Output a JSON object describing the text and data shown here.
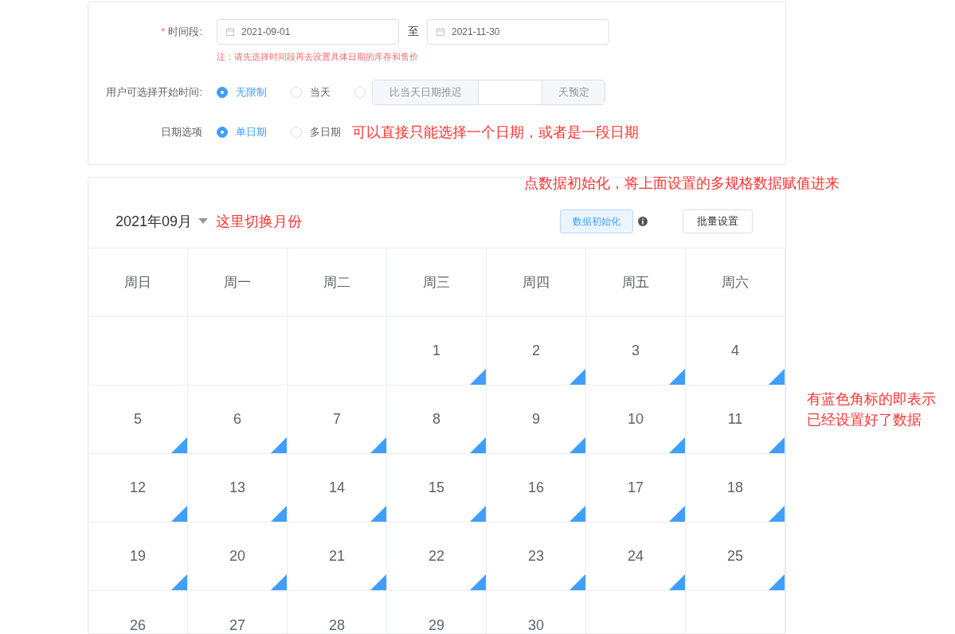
{
  "form": {
    "period": {
      "label": "时间段:",
      "required_mark": "*",
      "start": "2021-09-01",
      "separator": "至",
      "end": "2021-11-30",
      "note": "注：请先选择时间段再去设置具体日期的库存和售价"
    },
    "start_time": {
      "label": "用户可选择开始时间:",
      "options": [
        {
          "kind": "radio",
          "label": "无限制",
          "selected": true
        },
        {
          "kind": "radio",
          "label": "当天",
          "selected": false
        },
        {
          "kind": "delay",
          "selected": false,
          "prefix": "比当天日期推迟",
          "suffix": "天预定"
        }
      ]
    },
    "date_option": {
      "label": "日期选项",
      "options": [
        {
          "kind": "radio",
          "label": "单日期",
          "selected": true
        },
        {
          "kind": "radio",
          "label": "多日期",
          "selected": false
        }
      ],
      "note": "可以直接只能选择一个日期，或者是一段日期"
    }
  },
  "calendar": {
    "month": "2021年09月",
    "month_note": "这里切换月份",
    "init_note": "点数据初始化，将上面设置的多规格数据赋值进来",
    "init_button": "数据初始化",
    "batch_button": "批量设置",
    "side_note": "有蓝色角标的即表示已经设置好了数据",
    "weekdays": [
      "周日",
      "周一",
      "周二",
      "周三",
      "周四",
      "周五",
      "周六"
    ],
    "weeks": [
      [
        {
          "kind": "blank"
        },
        {
          "kind": "blank"
        },
        {
          "kind": "blank"
        },
        {
          "kind": "day",
          "day": "1",
          "corner": true
        },
        {
          "kind": "day",
          "day": "2",
          "corner": true
        },
        {
          "kind": "day",
          "day": "3",
          "corner": true
        },
        {
          "kind": "day",
          "day": "4",
          "corner": true
        }
      ],
      [
        {
          "kind": "day",
          "day": "5",
          "corner": true
        },
        {
          "kind": "day",
          "day": "6",
          "corner": true
        },
        {
          "kind": "day",
          "day": "7",
          "corner": true
        },
        {
          "kind": "day",
          "day": "8",
          "corner": true
        },
        {
          "kind": "day",
          "day": "9",
          "corner": true
        },
        {
          "kind": "day",
          "day": "10",
          "corner": true
        },
        {
          "kind": "day",
          "day": "11",
          "corner": true
        }
      ],
      [
        {
          "kind": "day",
          "day": "12",
          "corner": true
        },
        {
          "kind": "day",
          "day": "13",
          "corner": true
        },
        {
          "kind": "day",
          "day": "14",
          "corner": true
        },
        {
          "kind": "day",
          "day": "15",
          "corner": true
        },
        {
          "kind": "day",
          "day": "16",
          "corner": true
        },
        {
          "kind": "day",
          "day": "17",
          "corner": true
        },
        {
          "kind": "day",
          "day": "18",
          "corner": true
        }
      ],
      [
        {
          "kind": "day",
          "day": "19",
          "corner": true
        },
        {
          "kind": "day",
          "day": "20",
          "corner": true
        },
        {
          "kind": "day",
          "day": "21",
          "corner": true
        },
        {
          "kind": "day",
          "day": "22",
          "corner": true
        },
        {
          "kind": "day",
          "day": "23",
          "corner": true
        },
        {
          "kind": "day",
          "day": "24",
          "corner": true
        },
        {
          "kind": "day",
          "day": "25",
          "corner": true
        }
      ],
      [
        {
          "kind": "day",
          "day": "26"
        },
        {
          "kind": "day",
          "day": "27"
        },
        {
          "kind": "day",
          "day": "28"
        },
        {
          "kind": "day",
          "day": "29"
        },
        {
          "kind": "day",
          "day": "30"
        },
        {
          "kind": "blank"
        },
        {
          "kind": "blank"
        }
      ]
    ]
  }
}
